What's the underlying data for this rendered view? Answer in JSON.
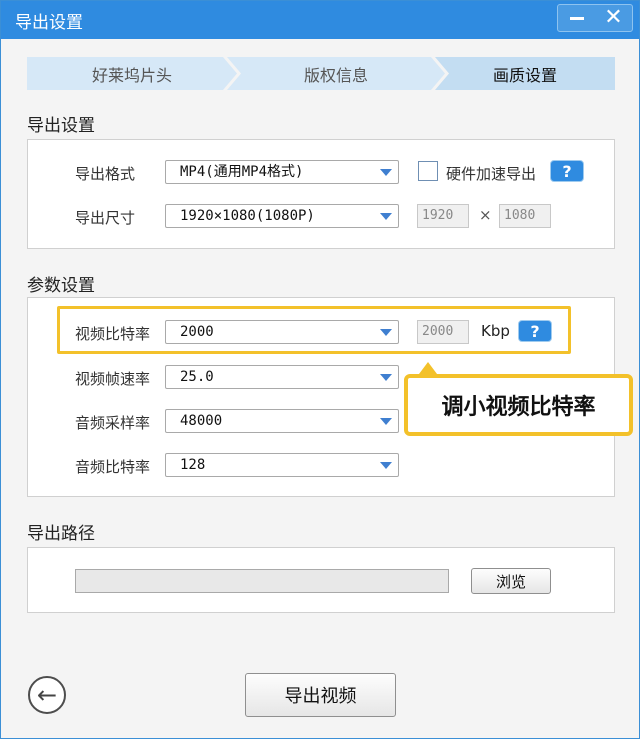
{
  "window": {
    "title": "导出设置",
    "minimize_icon": "minimize-icon",
    "close_icon": "close-icon",
    "close_symbol": "✕"
  },
  "steps": [
    {
      "label": "好莱坞片头",
      "active": false
    },
    {
      "label": "版权信息",
      "active": false
    },
    {
      "label": "画质设置",
      "active": true
    }
  ],
  "export_settings": {
    "section_title": "导出设置",
    "format_label": "导出格式",
    "format_value": "MP4(通用MP4格式)",
    "hw_accel_label": "硬件加速导出",
    "hw_accel_checked": false,
    "help_symbol": "?",
    "size_label": "导出尺寸",
    "size_value": "1920×1080(1080P)",
    "width_value": "1920",
    "times_symbol": "×",
    "height_value": "1080"
  },
  "params": {
    "section_title": "参数设置",
    "video_bitrate_label": "视频比特率",
    "video_bitrate_value": "2000",
    "video_bitrate_readonly": "2000",
    "video_bitrate_unit": "Kbp",
    "framerate_label": "视频帧速率",
    "framerate_value": "25.0",
    "audio_samplerate_label": "音频采样率",
    "audio_samplerate_value": "48000",
    "audio_bitrate_label": "音频比特率",
    "audio_bitrate_value": "128"
  },
  "callout": {
    "text": "调小视频比特率",
    "highlight_color": "#f3c12a"
  },
  "export_path": {
    "section_title": "导出路径",
    "path_value": "",
    "browse_label": "浏览"
  },
  "footer": {
    "back_symbol": "←",
    "export_button_label": "导出视频"
  },
  "colors": {
    "accent": "#2f8be0",
    "tab_bg": "#d6e8f7",
    "highlight": "#f3c12a"
  }
}
